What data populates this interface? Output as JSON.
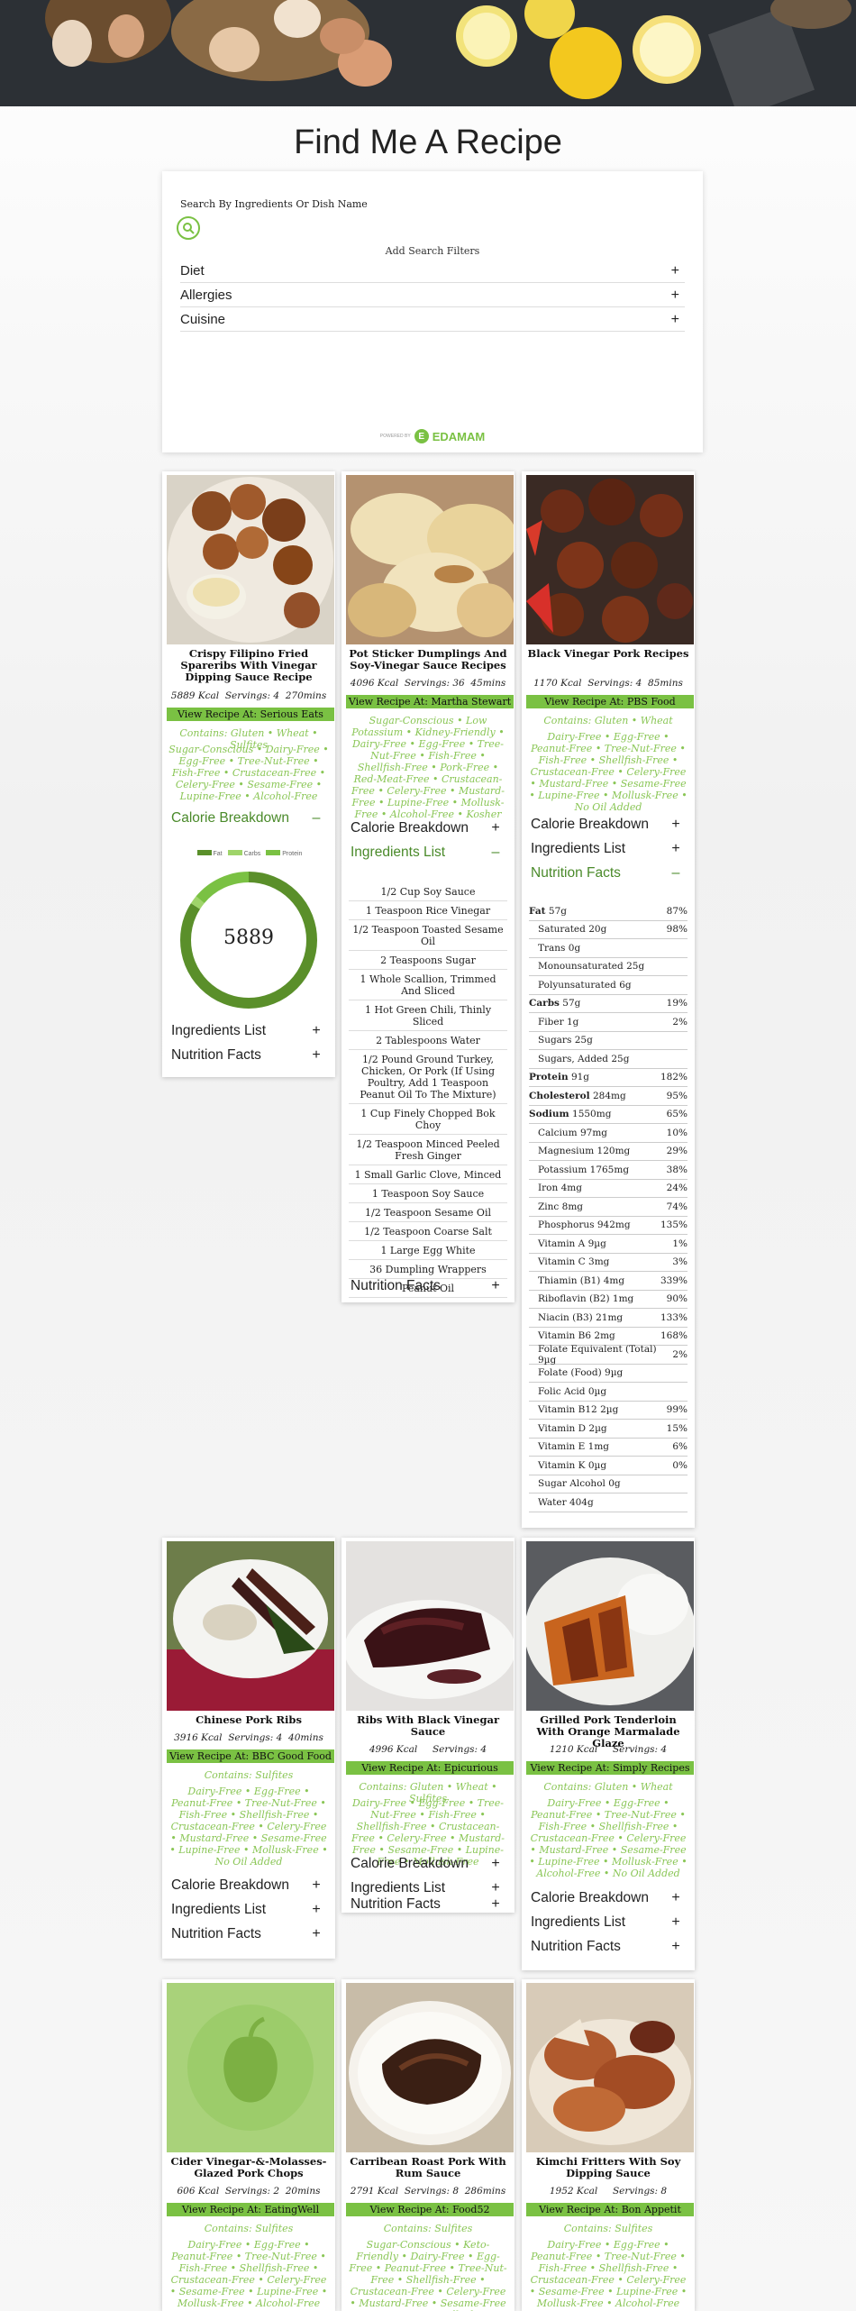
{
  "page_title": "Find Me A Recipe",
  "search": {
    "label": "Search By Ingredients Or Dish Name",
    "add_filters": "Add Search Filters"
  },
  "filters": [
    {
      "label": "Diet",
      "sign": "+"
    },
    {
      "label": "Allergies",
      "sign": "+"
    },
    {
      "label": "Cuisine",
      "sign": "+"
    }
  ],
  "powered_by": {
    "prefix": "POWERED BY",
    "logo_letter": "E",
    "brand": "EDAMAM"
  },
  "colors": {
    "accent": "#7ac143",
    "label_green": "#8ac656",
    "dark_green": "#4a8a2a"
  },
  "recipes": [
    {
      "name": "Crispy Filipino Fried Spareribs With Vinegar Dipping Sauce Recipe",
      "kcal": "5889 Kcal",
      "servings": "Servings: 4",
      "time": "270mins",
      "source": "View Recipe At: Serious Eats",
      "contains": "Contains: Gluten • Wheat • Sulfites",
      "labels": "Sugar-Conscious • Dairy-Free • Egg-Free • Tree-Nut-Free • Fish-Free • Crustacean-Free • Celery-Free • Sesame-Free • Lupine-Free • Alcohol-Free",
      "calorie_label": "Calorie Breakdown",
      "calorie_sign": "–",
      "ingredients_label": "Ingredients List",
      "ingredients_sign": "+",
      "nutrition_label": "Nutrition Facts",
      "nutrition_sign": "+",
      "donut": {
        "center": "5889",
        "legend": [
          "Fat",
          "Carbs",
          "Protein"
        ],
        "fat_fraction": 0.84,
        "carbs_fraction": 0.02,
        "protein_fraction": 0.14
      }
    },
    {
      "name": "Pot Sticker Dumplings And Soy-Vinegar Sauce Recipes",
      "kcal": "4096 Kcal",
      "servings": "Servings: 36",
      "time": "45mins",
      "source": "View Recipe At: Martha Stewart",
      "contains": "",
      "labels": "Sugar-Conscious • Low Potassium • Kidney-Friendly • Dairy-Free • Egg-Free • Tree-Nut-Free • Fish-Free • Shellfish-Free • Pork-Free • Red-Meat-Free • Crustacean-Free • Celery-Free • Mustard-Free • Lupine-Free • Mollusk-Free • Alcohol-Free • Kosher",
      "calorie_label": "Calorie Breakdown",
      "calorie_sign": "+",
      "ingredients_label": "Ingredients List",
      "ingredients_sign": "–",
      "nutrition_label": "Nutrition Facts",
      "nutrition_sign": "+",
      "ingredients": [
        "1/2 Cup Soy Sauce",
        "1 Teaspoon Rice Vinegar",
        "1/2 Teaspoon Toasted Sesame Oil",
        "2 Teaspoons Sugar",
        "1 Whole Scallion, Trimmed And Sliced",
        "1 Hot Green Chili, Thinly Sliced",
        "2 Tablespoons Water",
        "1/2 Pound Ground Turkey, Chicken, Or Pork (If Using Poultry, Add 1 Teaspoon Peanut Oil To The Mixture)",
        "1 Cup Finely Chopped Bok Choy",
        "1/2 Teaspoon Minced Peeled Fresh Ginger",
        "1 Small Garlic Clove, Minced",
        "1 Teaspoon Soy Sauce",
        "1/2 Teaspoon Sesame Oil",
        "1/2 Teaspoon Coarse Salt",
        "1 Large Egg White",
        "36 Dumpling Wrappers",
        "Peanut Oil"
      ]
    },
    {
      "name": "Black Vinegar Pork Recipes",
      "kcal": "1170 Kcal",
      "servings": "Servings: 4",
      "time": "85mins",
      "source": "View Recipe At: PBS Food",
      "contains": "Contains: Gluten • Wheat",
      "labels": "Dairy-Free • Egg-Free • Peanut-Free • Tree-Nut-Free • Fish-Free • Shellfish-Free • Crustacean-Free • Celery-Free • Mustard-Free • Sesame-Free • Lupine-Free • Mollusk-Free • No Oil Added",
      "calorie_label": "Calorie Breakdown",
      "calorie_sign": "+",
      "ingredients_label": "Ingredients List",
      "ingredients_sign": "+",
      "nutrition_label": "Nutrition Facts",
      "nutrition_sign": "–",
      "nutrition": [
        {
          "name": "Fat",
          "value": "57g",
          "pct": "87%",
          "kind": "main"
        },
        {
          "name": "Saturated",
          "value": "20g",
          "pct": "98%",
          "kind": "sub"
        },
        {
          "name": "Trans",
          "value": "0g",
          "pct": "",
          "kind": "sub"
        },
        {
          "name": "Monounsaturated",
          "value": "25g",
          "pct": "",
          "kind": "sub"
        },
        {
          "name": "Polyunsaturated",
          "value": "6g",
          "pct": "",
          "kind": "sub"
        },
        {
          "name": "Carbs",
          "value": "57g",
          "pct": "19%",
          "kind": "main"
        },
        {
          "name": "Fiber",
          "value": "1g",
          "pct": "2%",
          "kind": "sub"
        },
        {
          "name": "Sugars",
          "value": "25g",
          "pct": "",
          "kind": "sub"
        },
        {
          "name": "Sugars, Added",
          "value": "25g",
          "pct": "",
          "kind": "sub"
        },
        {
          "name": "Protein",
          "value": "91g",
          "pct": "182%",
          "kind": "main"
        },
        {
          "name": "Cholesterol",
          "value": "284mg",
          "pct": "95%",
          "kind": "main"
        },
        {
          "name": "Sodium",
          "value": "1550mg",
          "pct": "65%",
          "kind": "main"
        },
        {
          "name": "Calcium",
          "value": "97mg",
          "pct": "10%",
          "kind": "sub"
        },
        {
          "name": "Magnesium",
          "value": "120mg",
          "pct": "29%",
          "kind": "sub"
        },
        {
          "name": "Potassium",
          "value": "1765mg",
          "pct": "38%",
          "kind": "sub"
        },
        {
          "name": "Iron",
          "value": "4mg",
          "pct": "24%",
          "kind": "sub"
        },
        {
          "name": "Zinc",
          "value": "8mg",
          "pct": "74%",
          "kind": "sub"
        },
        {
          "name": "Phosphorus",
          "value": "942mg",
          "pct": "135%",
          "kind": "sub"
        },
        {
          "name": "Vitamin A",
          "value": "9µg",
          "pct": "1%",
          "kind": "sub"
        },
        {
          "name": "Vitamin C",
          "value": "3mg",
          "pct": "3%",
          "kind": "sub"
        },
        {
          "name": "Thiamin (B1)",
          "value": "4mg",
          "pct": "339%",
          "kind": "sub"
        },
        {
          "name": "Riboflavin (B2)",
          "value": "1mg",
          "pct": "90%",
          "kind": "sub"
        },
        {
          "name": "Niacin (B3)",
          "value": "21mg",
          "pct": "133%",
          "kind": "sub"
        },
        {
          "name": "Vitamin B6",
          "value": "2mg",
          "pct": "168%",
          "kind": "sub"
        },
        {
          "name": "Folate Equivalent (Total)",
          "value": "9µg",
          "pct": "2%",
          "kind": "sub"
        },
        {
          "name": "Folate (Food)",
          "value": "9µg",
          "pct": "",
          "kind": "sub"
        },
        {
          "name": "Folic Acid",
          "value": "0µg",
          "pct": "",
          "kind": "sub"
        },
        {
          "name": "Vitamin B12",
          "value": "2µg",
          "pct": "99%",
          "kind": "sub"
        },
        {
          "name": "Vitamin D",
          "value": "2µg",
          "pct": "15%",
          "kind": "sub"
        },
        {
          "name": "Vitamin E",
          "value": "1mg",
          "pct": "6%",
          "kind": "sub"
        },
        {
          "name": "Vitamin K",
          "value": "0µg",
          "pct": "0%",
          "kind": "sub"
        },
        {
          "name": "Sugar Alcohol",
          "value": "0g",
          "pct": "",
          "kind": "sub"
        },
        {
          "name": "Water",
          "value": "404g",
          "pct": "",
          "kind": "sub"
        }
      ]
    },
    {
      "name": "Chinese Pork Ribs",
      "kcal": "3916 Kcal",
      "servings": "Servings: 4",
      "time": "40mins",
      "source": "View Recipe At: BBC Good Food",
      "contains": "Contains: Sulfites",
      "labels": "Dairy-Free • Egg-Free • Peanut-Free • Tree-Nut-Free • Fish-Free • Shellfish-Free • Crustacean-Free • Celery-Free • Mustard-Free • Sesame-Free • Lupine-Free • Mollusk-Free • No Oil Added",
      "calorie_label": "Calorie Breakdown",
      "calorie_sign": "+",
      "ingredients_label": "Ingredients List",
      "ingredients_sign": "+",
      "nutrition_label": "Nutrition Facts",
      "nutrition_sign": "+"
    },
    {
      "name": "Ribs With Black Vinegar Sauce",
      "kcal": "4996 Kcal",
      "servings": "Servings: 4",
      "time": "",
      "source": "View Recipe At: Epicurious",
      "contains": "Contains: Gluten • Wheat • Sulfites",
      "labels": "Dairy-Free • Egg-Free • Tree-Nut-Free • Fish-Free • Shellfish-Free • Crustacean-Free • Celery-Free • Mustard-Free • Sesame-Free • Lupine-Free • Mollusk-Free",
      "calorie_label": "Calorie Breakdown",
      "calorie_sign": "+",
      "ingredients_label": "Ingredients List",
      "ingredients_sign": "+",
      "nutrition_label": "Nutrition Facts",
      "nutrition_sign": "+"
    },
    {
      "name": "Grilled Pork Tenderloin With Orange Marmalade Glaze",
      "kcal": "1210 Kcal",
      "servings": "Servings: 4",
      "time": "",
      "source": "View Recipe At: Simply Recipes",
      "contains": "Contains: Gluten • Wheat",
      "labels": "Dairy-Free • Egg-Free • Peanut-Free • Tree-Nut-Free • Fish-Free • Shellfish-Free • Crustacean-Free • Celery-Free • Mustard-Free • Sesame-Free • Lupine-Free • Mollusk-Free • Alcohol-Free • No Oil Added",
      "calorie_label": "Calorie Breakdown",
      "calorie_sign": "+",
      "ingredients_label": "Ingredients List",
      "ingredients_sign": "+",
      "nutrition_label": "Nutrition Facts",
      "nutrition_sign": "+"
    },
    {
      "name": "Cider Vinegar-&-Molasses-Glazed Pork Chops",
      "kcal": "606 Kcal",
      "servings": "Servings: 2",
      "time": "20mins",
      "source": "View Recipe At: EatingWell",
      "contains": "Contains: Sulfites",
      "labels": "Dairy-Free • Egg-Free • Peanut-Free • Tree-Nut-Free • Fish-Free • Shellfish-Free • Crustacean-Free • Celery-Free • Sesame-Free • Lupine-Free • Mollusk-Free • Alcohol-Free"
    },
    {
      "name": "Carribean Roast Pork With Rum Sauce",
      "kcal": "2791 Kcal",
      "servings": "Servings: 8",
      "time": "286mins",
      "source": "View Recipe At: Food52",
      "contains": "Contains: Sulfites",
      "labels": "Sugar-Conscious • Keto-Friendly • Dairy-Free • Egg-Free • Peanut-Free • Tree-Nut-Free • Shellfish-Free • Crustacean-Free • Celery-Free • Mustard-Free • Sesame-Free • Lupine-Free • Mollusk-Free"
    },
    {
      "name": "Kimchi Fritters With Soy Dipping Sauce",
      "kcal": "1952 Kcal",
      "servings": "Servings: 8",
      "time": "",
      "source": "View Recipe At: Bon Appetit",
      "contains": "Contains: Sulfites",
      "labels": "Dairy-Free • Egg-Free • Peanut-Free • Tree-Nut-Free • Fish-Free • Shellfish-Free • Crustacean-Free • Celery-Free • Sesame-Free • Lupine-Free • Mollusk-Free • Alcohol-Free"
    }
  ]
}
